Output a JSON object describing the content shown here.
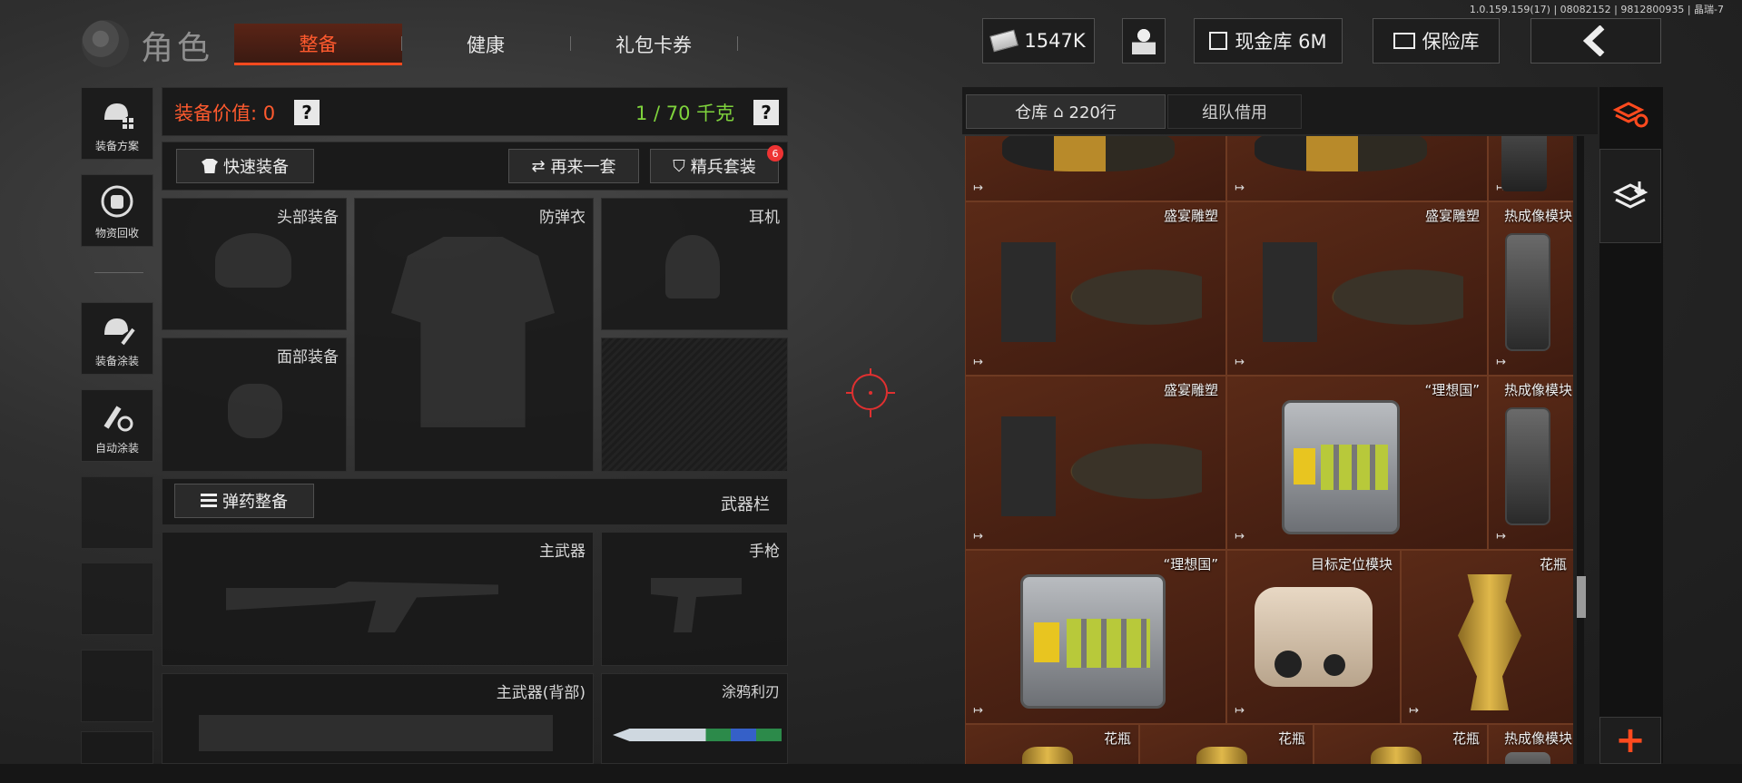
{
  "version": "1.0.159.159(17) | 08082152 | 9812800935 | 晶瑞-7",
  "header": {
    "title": "角色",
    "tabs": [
      "整备",
      "健康",
      "礼包卡券"
    ],
    "active_tab": "整备",
    "money": "1547K",
    "cash_vault": "现金库 6M",
    "safe": "保险库",
    "back_icon": "back-arrow-icon"
  },
  "sidebar": {
    "items": [
      "装备方案",
      "物资回收",
      "装备涂装",
      "自动涂装"
    ]
  },
  "equipment": {
    "value_label": "装备价值: 0",
    "weight": "1 / 70 千克",
    "help": "?",
    "quick_equip": "快速装备",
    "again": "再来一套",
    "elite": "精兵套装",
    "elite_badge": "6",
    "slots": {
      "head": "头部装备",
      "armor": "防弹衣",
      "headset": "耳机",
      "face": "面部装备"
    },
    "ammo": "弹药整备",
    "weapon_bar": "武器栏",
    "primary": "主武器",
    "pistol": "手枪",
    "primary_back": "主武器(背部)",
    "melee": "涂鸦利刃"
  },
  "storage": {
    "tab_warehouse": "仓库",
    "rows": "220行",
    "tab_team": "组队借用",
    "items": {
      "sculpture": "盛宴雕塑",
      "thermal": "热成像模块",
      "utopia": "“理想国”",
      "target_module": "目标定位模块",
      "vase": "花瓶"
    },
    "move_icon": "↦"
  },
  "colors": {
    "accent": "#ff4a1e",
    "weight_green": "#7fd33c",
    "grid_bg": "#4a2314"
  }
}
